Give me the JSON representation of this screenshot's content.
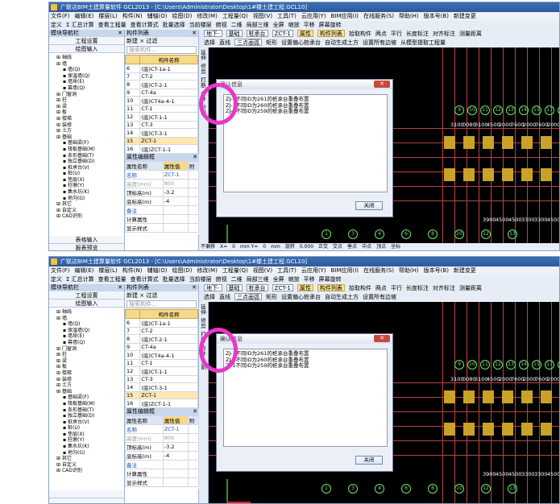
{
  "screens": [
    {
      "title": "广联达BIM土建算量软件 GCL2013 - [C:\\Users\\Administrator\\Desktop\\1#楼土建工程.GCL10]",
      "menu": [
        "文件(F)",
        "编辑(E)",
        "楼层(L)",
        "构件(N)",
        "辅轴(O)",
        "绘图(D)",
        "修改(M)",
        "工程量(Q)",
        "视图(V)",
        "工具(T)",
        "云应用(Y)",
        "BIM应用(I)",
        "在线服务(S)",
        "帮助(H)",
        "版本号(B)",
        "新建变更"
      ],
      "tool1": [
        "定义",
        "Σ 汇总计算",
        "查看工程量",
        "查看计算式",
        "批量选择",
        "当前楼层",
        "俯视",
        "二维",
        "局部三维",
        "全屏",
        "缩放",
        "平移",
        "屏幕旋转"
      ],
      "tool2": {
        "floor": "地下-",
        "type": "基础",
        "item": "桩承台",
        "comp": "ZCT-1",
        "btns": [
          "属性",
          "构件列表",
          "拾取构件",
          "两点",
          "平行",
          "长度标注",
          "对齐标注",
          "测量距离"
        ]
      },
      "tool3": {
        "sel": "选择",
        "line": "直线",
        "arc": "三点画弧",
        "rect": "矩形",
        "btns": [
          "设置偏心桩承台",
          "自动生成土方",
          "设置所有边坡"
        ],
        "right": "从模型提取工程量"
      },
      "nav": {
        "title": "模块导航栏",
        "btn1": "工程设置",
        "btn2": "绘图输入",
        "bottom1": "表格输入",
        "bottom2": "报表预览",
        "tree": [
          "轴线",
          "墙",
          "墙(Q)",
          "保温墙(Q)",
          "墙垛(E)",
          "幕墙(Q)",
          "门窗洞",
          "柱",
          "梁",
          "板",
          "楼梯",
          "装修",
          "土方",
          "基础",
          "基础梁(F)",
          "筏板基础(M)",
          "条形基础(T)",
          "独立基础(D)",
          "桩承台(V)",
          "桩(U)",
          "垫层(X)",
          "柱墩(Y)",
          "集水坑(K)",
          "地沟(G)",
          "其它",
          "自定义",
          "CAD识别"
        ]
      },
      "clist": {
        "title": "构件列表",
        "new": "新建",
        "del": "×",
        "filter": "过滤",
        "search": "搜索构件...",
        "header": "构件名称",
        "rows": [
          [
            "6",
            "(底)CT-1a-1"
          ],
          [
            "7",
            "CT-2"
          ],
          [
            "8",
            "(底)CT-2-1"
          ],
          [
            "9",
            "CT-4a"
          ],
          [
            "10",
            "(底)CT4a-4-1"
          ],
          [
            "11",
            "CT-1"
          ],
          [
            "12",
            "(底)CT-1-1"
          ],
          [
            "13",
            "CT-3"
          ],
          [
            "14",
            "(底)CT-3-1"
          ],
          [
            "15",
            "ZCT-1"
          ],
          [
            "16",
            "(底)ZCT-1-1"
          ]
        ]
      },
      "props": {
        "title": "属性编辑框",
        "h1": "属性名称",
        "h2": "属性值",
        "h3": "附",
        "rows": [
          [
            "名称",
            "ZCT-1"
          ],
          [
            "高度(mm)",
            "800"
          ],
          [
            "顶标高(m)",
            "-3.2"
          ],
          [
            "底标高(m)",
            "-4"
          ],
          [
            "备注",
            ""
          ],
          [
            "计算属性",
            ""
          ],
          [
            "显示样式",
            ""
          ]
        ]
      },
      "vtool": [
        "延伸",
        "修剪",
        "打断",
        "合并",
        "分割"
      ],
      "dialog": {
        "title": "确认信息",
        "lines": [
          "ZJ-1不同ID为261的桩承台重叠布置",
          "ZJ-1不同ID为260的桩承台重叠布置",
          "ZJ-1不同ID为259的桩承台重叠布置"
        ],
        "ok": "关闭"
      },
      "axis_top": [
        "9",
        "10",
        "11",
        "12",
        "13",
        "14",
        "15",
        "17",
        "18"
      ],
      "dims_top": [
        "3100",
        "0080",
        "3100",
        "4500",
        "2000",
        "7600",
        "2000",
        "7600",
        "2000"
      ],
      "dims_bot": [
        "3900",
        "4500",
        "4500",
        "3300",
        "3300",
        "4500"
      ],
      "axis_bot": [
        "1",
        "3",
        "4",
        "6",
        "8",
        "10",
        "12",
        "13"
      ],
      "status": [
        "不偏移",
        "X=",
        "0",
        "mm Y=",
        "0",
        "mm",
        "旋转",
        "0.000",
        "正交",
        "交点",
        "垂点",
        "中点",
        "顶点",
        "坐标"
      ]
    },
    {
      "title": "广联达BIM土建算量软件 GCL2013 - [C:\\Users\\Administrator\\Desktop\\1#楼土建工程.GCL10]",
      "menu": [
        "文件(F)",
        "编辑(E)",
        "楼层(L)",
        "构件(N)",
        "辅轴(O)",
        "绘图(D)",
        "修改(M)",
        "工程量(Q)",
        "视图(V)",
        "工具(T)",
        "云应用(Y)",
        "BIM应用(I)",
        "在线服务(S)",
        "帮助(H)",
        "版本号(B)",
        "新建变更"
      ],
      "tool1": [
        "定义",
        "Σ 汇总计算",
        "查看工程量",
        "查看计算式",
        "批量选择",
        "当前楼层",
        "俯视",
        "二维",
        "局部三维",
        "全屏",
        "缩放",
        "平移",
        "屏幕旋转"
      ],
      "tool2": {
        "floor": "地下-",
        "type": "基础",
        "item": "桩承台",
        "comp": "ZCT-1",
        "btns": [
          "属性",
          "构件列表",
          "拾取构件",
          "两点",
          "平行",
          "长度标注",
          "对齐标注",
          "测量距离"
        ]
      },
      "tool3": {
        "sel": "选择",
        "line": "直线",
        "arc": "三点画弧",
        "rect": "矩形",
        "btns": [
          "设置偏心桩承台",
          "自动生成土方",
          "设置所有边坡"
        ],
        "right": ""
      },
      "nav": {
        "title": "模块导航栏",
        "btn1": "工程设置",
        "btn2": "绘图输入",
        "bottom1": "",
        "bottom2": "",
        "tree": [
          "轴线",
          "墙",
          "墙(Q)",
          "保温墙(Q)",
          "墙垛(E)",
          "幕墙(Q)",
          "门窗洞",
          "柱",
          "梁",
          "板",
          "楼梯",
          "装修",
          "土方",
          "基础",
          "基础梁(F)",
          "筏板基础(M)",
          "条形基础(T)",
          "独立基础(D)",
          "桩承台(V)",
          "桩(U)",
          "垫层(X)",
          "柱墩(Y)",
          "集水坑(K)",
          "地沟(G)",
          "其它",
          "自定义",
          "CAD识别"
        ]
      },
      "clist": {
        "title": "构件列表",
        "new": "新建",
        "del": "×",
        "filter": "过滤",
        "search": "搜索构件...",
        "header": "构件名称",
        "rows": [
          [
            "6",
            "(底)CT-1a-1"
          ],
          [
            "7",
            "CT-2"
          ],
          [
            "8",
            "(底)CT-2-1"
          ],
          [
            "9",
            "CT-4a"
          ],
          [
            "10",
            "(底)CT4a-4-1"
          ],
          [
            "11",
            "CT-1"
          ],
          [
            "12",
            "(底)CT-1-1"
          ],
          [
            "13",
            "CT-3"
          ],
          [
            "14",
            "(底)CT-3-1"
          ],
          [
            "15",
            "ZCT-1"
          ],
          [
            "16",
            "(底)ZCT-1-1"
          ]
        ]
      },
      "props": {
        "title": "属性编辑框",
        "h1": "属性名称",
        "h2": "属性值",
        "h3": "附",
        "rows": [
          [
            "名称",
            "ZCT-1"
          ],
          [
            "高度(mm)",
            "800"
          ],
          [
            "顶标高(m)",
            "-3.2"
          ],
          [
            "底标高(m)",
            "-4"
          ],
          [
            "备注",
            ""
          ],
          [
            "计算属性",
            ""
          ],
          [
            "显示样式",
            ""
          ]
        ]
      },
      "vtool": [
        "延伸",
        "修剪",
        "打断",
        "合并",
        "分割"
      ],
      "dialog": {
        "title": "确认信息",
        "lines": [
          "ZJ-1不同ID为261的桩承台重叠布置",
          "ZJ-1不同ID为260的桩承台重叠布置",
          "ZJ-1不同ID为259的桩承台重叠布置"
        ],
        "ok": "关闭"
      },
      "axis_top": [
        "9",
        "10",
        "11",
        "12",
        "13",
        "14",
        "15",
        "17",
        "18"
      ],
      "dims_top": [
        "3100",
        "0080",
        "3100",
        "4500",
        "2000",
        "7600",
        "2000",
        "7600",
        "2000"
      ],
      "dims_bot": [
        "3900",
        "4500",
        "4500",
        "3300",
        "3300",
        "4500"
      ],
      "axis_bot": [
        "1",
        "3",
        "4",
        "6",
        "8",
        "10",
        "12",
        "13"
      ],
      "status": []
    }
  ],
  "colors": {
    "highlight_ring": "#ea36c9",
    "cad_bg": "#000000",
    "axis_green": "#6fe36f",
    "footing_yellow": "#c9a227"
  }
}
